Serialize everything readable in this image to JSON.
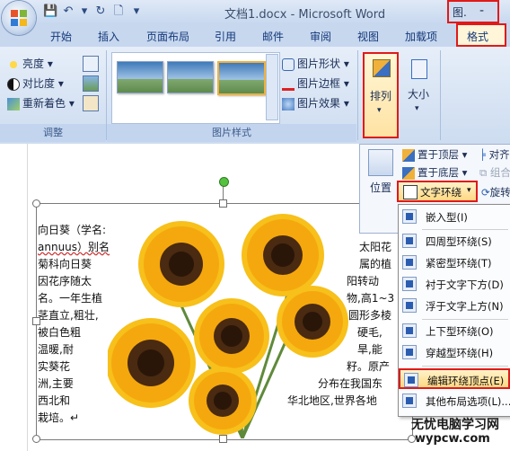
{
  "window": {
    "title": "文档1.docx - Microsoft Word",
    "image_btn": "图.",
    "min_btn": "-"
  },
  "quick_access": {
    "save": "💾",
    "undo": "↶",
    "redo": "↻",
    "new": "🗋",
    "more": "▾"
  },
  "tabs": [
    "开始",
    "插入",
    "页面布局",
    "引用",
    "邮件",
    "审阅",
    "视图",
    "加载项"
  ],
  "active_tab": "格式",
  "ribbon": {
    "adjust": {
      "brightness": "亮度",
      "contrast": "对比度",
      "recolor": "重新着色",
      "label": "调整"
    },
    "picture_styles": {
      "shape": "图片形状",
      "border": "图片边框",
      "effects": "图片效果",
      "label": "图片样式"
    },
    "arrange": {
      "label": "排列"
    },
    "size": {
      "label": "大小"
    }
  },
  "arrange_menu": {
    "bring_front": "置于顶层",
    "send_back": "置于底层",
    "align": "对齐",
    "group": "组合",
    "position": "位置",
    "text_wrap": "文字环绕",
    "rotate": "旋转"
  },
  "wrap_menu": [
    "嵌入型(I)",
    "四周型环绕(S)",
    "紧密型环绕(T)",
    "衬于文字下方(D)",
    "浮于文字上方(N)",
    "上下型环绕(O)",
    "穿越型环绕(H)",
    "编辑环绕顶点(E)",
    "其他布局选项(L)..."
  ],
  "doc": {
    "left_lines": [
      "向日葵（学名:",
      "annuus）别名",
      "菊科向日葵",
      "因花序随太",
      "名。一年生植",
      "茎直立,粗壮,",
      "被白色粗",
      "温暖,耐",
      "实葵花",
      "洲,主要",
      "西北和",
      "栽培。↵"
    ],
    "right_lines": [
      "太阳花",
      "属的植",
      "阳转动",
      "物,高1~3",
      "圆形多棱",
      "硬毛,",
      "旱,能",
      "籽。原产",
      "分布在我国东",
      "华北地区,世界各地"
    ]
  },
  "watermark": {
    "brand": "无忧电脑学习网",
    "url": "wypcw.com"
  }
}
